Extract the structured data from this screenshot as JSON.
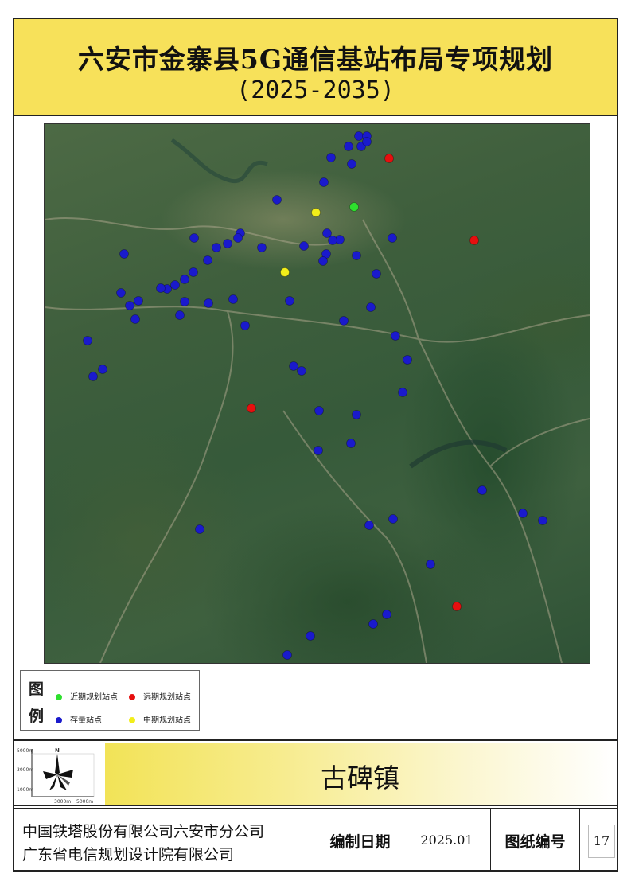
{
  "title": {
    "line1": "六安市金寨县5G通信基站布局专项规划",
    "line2": "(2025-2035)"
  },
  "legend": {
    "heading_top": "图",
    "heading_bottom": "例",
    "items": [
      {
        "label": "近期规划站点",
        "color": "#2ee02e"
      },
      {
        "label": "远期规划站点",
        "color": "#e60f0f"
      },
      {
        "label": "存量站点",
        "color": "#1a1acc"
      },
      {
        "label": "中期规划站点",
        "color": "#f2ee1a"
      }
    ]
  },
  "compass": {
    "north_label": "N",
    "scale_labels": [
      "5000m",
      "3000m",
      "1000m",
      "3000m",
      "5000m"
    ]
  },
  "town_name": "古碑镇",
  "footer": {
    "org_line1": "中国铁塔股份有限公司六安市分公司",
    "org_line2": "广东省电信规划设计院有限公司",
    "date_label": "编制日期",
    "date_value": "2025.01",
    "sheet_label": "图纸编号",
    "sheet_value": "17"
  },
  "sites": {
    "existing_count": 66,
    "near_term_count": 1,
    "mid_term_count": 2,
    "long_term_count": 4
  }
}
